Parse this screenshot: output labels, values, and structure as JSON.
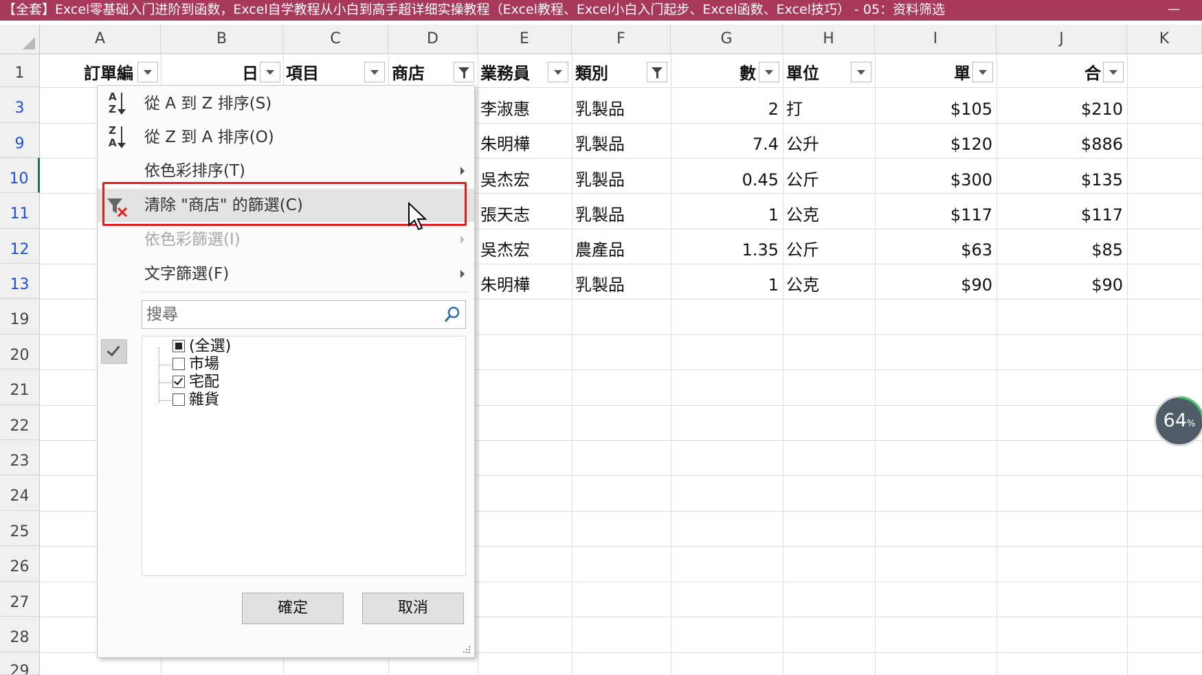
{
  "window": {
    "title": "【全套】Excel零基础入门进阶到函数，Excel自学教程从小白到高手超详细实操教程（Excel教程、Excel小白入门起步、Excel函数、Excel技巧） - 05：资料筛选",
    "minimize_label": "—"
  },
  "columns": [
    "A",
    "B",
    "C",
    "D",
    "E",
    "F",
    "G",
    "H",
    "I",
    "J",
    "K"
  ],
  "rows": [
    "1",
    "3",
    "9",
    "10",
    "11",
    "12",
    "13",
    "19",
    "20",
    "21",
    "22",
    "23",
    "24",
    "25",
    "26",
    "27",
    "28",
    "29"
  ],
  "header_row": {
    "a": "訂單編",
    "b": "日",
    "c": "項目",
    "d": "商店",
    "e": "業務員",
    "f": "類別",
    "g": "數",
    "h": "單位",
    "i": "單",
    "j": "合"
  },
  "data_rows": [
    {
      "e": "李淑惠",
      "f": "乳製品",
      "g": "2",
      "h": "打",
      "i": "$105",
      "j": "$210"
    },
    {
      "e": "朱明樺",
      "f": "乳製品",
      "g": "7.4",
      "h": "公升",
      "i": "$120",
      "j": "$886"
    },
    {
      "e": "吳杰宏",
      "f": "乳製品",
      "g": "0.45",
      "h": "公斤",
      "i": "$300",
      "j": "$135"
    },
    {
      "e": "張天志",
      "f": "乳製品",
      "g": "1",
      "h": "公克",
      "i": "$117",
      "j": "$117"
    },
    {
      "e": "吳杰宏",
      "f": "農產品",
      "g": "1.35",
      "h": "公斤",
      "i": "$63",
      "j": "$85"
    },
    {
      "e": "朱明樺",
      "f": "乳製品",
      "g": "1",
      "h": "公克",
      "i": "$90",
      "j": "$90"
    }
  ],
  "menu": {
    "sort_asc": "從 A 到 Z 排序(S)",
    "sort_desc": "從 Z 到 A 排序(O)",
    "sort_color": "依色彩排序(T)",
    "clear_filter": "清除 \"商店\" 的篩選(C)",
    "filter_color": "依色彩篩選(I)",
    "text_filter": "文字篩選(F)",
    "search_placeholder": "搜尋",
    "items": [
      {
        "label": "(全選)",
        "state": "partial"
      },
      {
        "label": "市場",
        "state": "unchecked"
      },
      {
        "label": "宅配",
        "state": "checked"
      },
      {
        "label": "雜貨",
        "state": "unchecked"
      }
    ],
    "ok": "確定",
    "cancel": "取消"
  },
  "sort_icon_asc": {
    "top": "A",
    "bottom": "Z"
  },
  "sort_icon_desc": {
    "top": "Z",
    "bottom": "A"
  },
  "badge": {
    "value": "64",
    "unit": "%"
  },
  "colors": {
    "titlebar": "#a8395a",
    "highlight": "#e41c1c",
    "row_link": "#1f4fd6"
  }
}
